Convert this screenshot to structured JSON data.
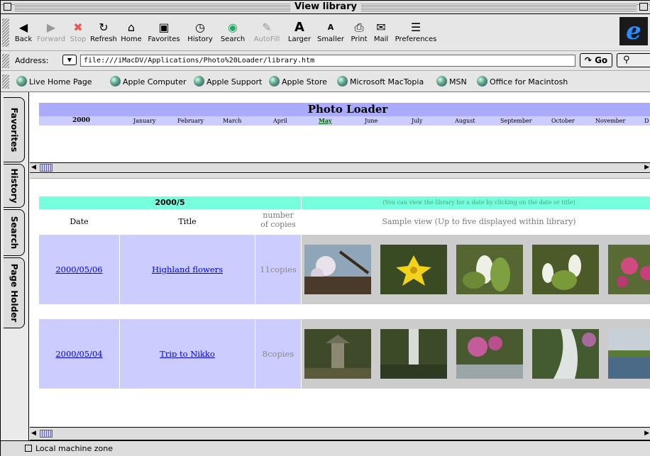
{
  "window": {
    "title": "View library"
  },
  "toolbar": {
    "buttons": [
      {
        "label": "Back",
        "icon": "back-arrow-icon",
        "enabled": true
      },
      {
        "label": "Forward",
        "icon": "forward-arrow-icon",
        "enabled": false
      },
      {
        "label": "Stop",
        "icon": "stop-icon",
        "enabled": false
      },
      {
        "label": "Refresh",
        "icon": "refresh-icon",
        "enabled": true
      },
      {
        "label": "Home",
        "icon": "home-icon",
        "enabled": true
      },
      {
        "label": "Favorites",
        "icon": "favorites-icon",
        "enabled": true
      },
      {
        "label": "History",
        "icon": "history-icon",
        "enabled": true
      },
      {
        "label": "Search",
        "icon": "search-icon",
        "enabled": true
      },
      {
        "label": "AutoFill",
        "icon": "autofill-icon",
        "enabled": false
      },
      {
        "label": "Larger",
        "icon": "larger-text-icon",
        "enabled": true
      },
      {
        "label": "Smaller",
        "icon": "smaller-text-icon",
        "enabled": true
      },
      {
        "label": "Print",
        "icon": "print-icon",
        "enabled": true
      },
      {
        "label": "Mail",
        "icon": "mail-icon",
        "enabled": true
      },
      {
        "label": "Preferences",
        "icon": "preferences-icon",
        "enabled": true
      }
    ]
  },
  "address": {
    "label": "Address:",
    "value": "file:///iMacDV/Applications/Photo%20Loader/library.htm",
    "go_label": "Go"
  },
  "favorites_bar": [
    "Live Home Page",
    "Apple Computer",
    "Apple Support",
    "Apple Store",
    "Microsoft MacTopia",
    "MSN",
    "Office for Macintosh"
  ],
  "side_tabs": [
    "Favorites",
    "History",
    "Search",
    "Page Holder"
  ],
  "top_frame": {
    "banner": "Photo Loader",
    "year": "2000",
    "months": [
      "January",
      "February",
      "March",
      "April",
      "May",
      "June",
      "July",
      "August",
      "September",
      "October",
      "November",
      "D"
    ],
    "selected_month": "May"
  },
  "library": {
    "header_left": "2000/5",
    "header_right": "(You can view the library for a date by clicking on the date or title)",
    "col_date": "Date",
    "col_title": "Title",
    "col_copies_1": "number",
    "col_copies_2": "of copies",
    "col_sample": "Sample view (Up to five displayed within library)",
    "rows": [
      {
        "date": "2000/05/06",
        "title": "Highland flowers",
        "copies": "11copies"
      },
      {
        "date": "2000/05/04",
        "title": "Trip to Nikko",
        "copies": "8copies"
      }
    ]
  },
  "status": {
    "text": "Local machine zone"
  }
}
